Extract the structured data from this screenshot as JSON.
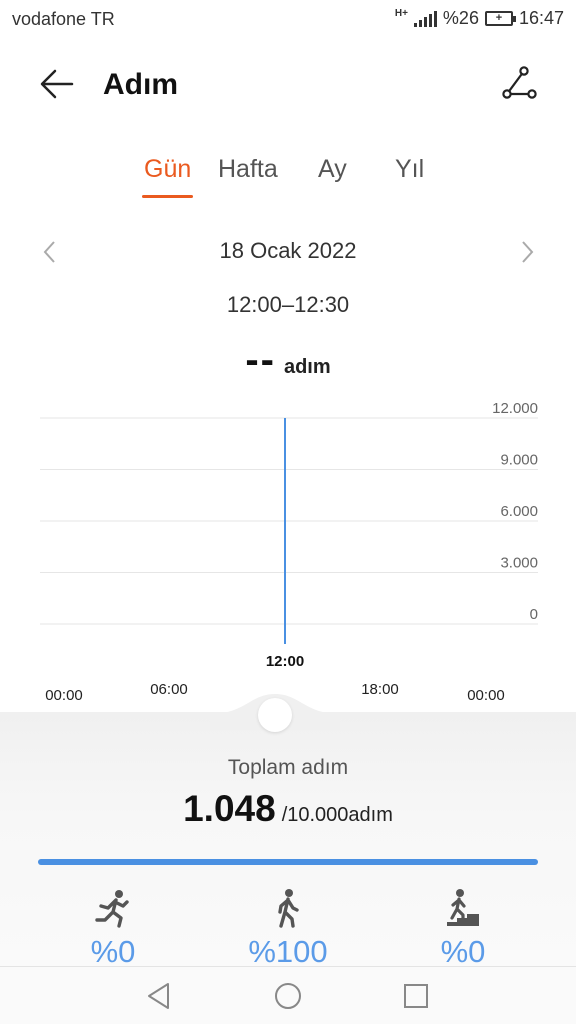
{
  "status_bar": {
    "carrier": "vodafone TR",
    "network": "H+",
    "battery": "%26",
    "time": "16:47"
  },
  "header": {
    "title": "Adım",
    "back_icon": "arrow-left-icon",
    "share_icon": "share-nodes-icon"
  },
  "tabs": [
    {
      "label": "Gün",
      "active": true
    },
    {
      "label": "Hafta",
      "active": false
    },
    {
      "label": "Ay",
      "active": false
    },
    {
      "label": "Yıl",
      "active": false
    }
  ],
  "date": "18 Ocak 2022",
  "time_range": "12:00–12:30",
  "selected_reading": {
    "value": "--",
    "unit": "adım"
  },
  "chart_data": {
    "type": "bar",
    "x_ticks": [
      "00:00",
      "06:00",
      "12:00",
      "18:00",
      "00:00"
    ],
    "selected_x": "12:00",
    "y_ticks": [
      "12.000",
      "9.000",
      "6.000",
      "3.000",
      "0"
    ],
    "ylim": [
      0,
      12000
    ],
    "grid": true,
    "series": [
      {
        "points": [
          {
            "x": "12:00",
            "y": 12000
          }
        ]
      }
    ],
    "colors": {
      "bar": "#4a90e2",
      "grid": "#e6e6e6"
    }
  },
  "summary": {
    "label": "Toplam adım",
    "total": "1.048",
    "goal": "/10.000adım",
    "progress": 1.0
  },
  "activities": [
    {
      "icon": "running-icon",
      "value": "%0"
    },
    {
      "icon": "walking-icon",
      "value": "%100"
    },
    {
      "icon": "stairs-climbing-icon",
      "value": "%0"
    }
  ],
  "nav": {
    "back": "nav-back-icon",
    "home": "nav-home-icon",
    "recents": "nav-recents-icon"
  },
  "colors": {
    "accent": "#ea5a1f",
    "chart_blue": "#4a90e2"
  }
}
